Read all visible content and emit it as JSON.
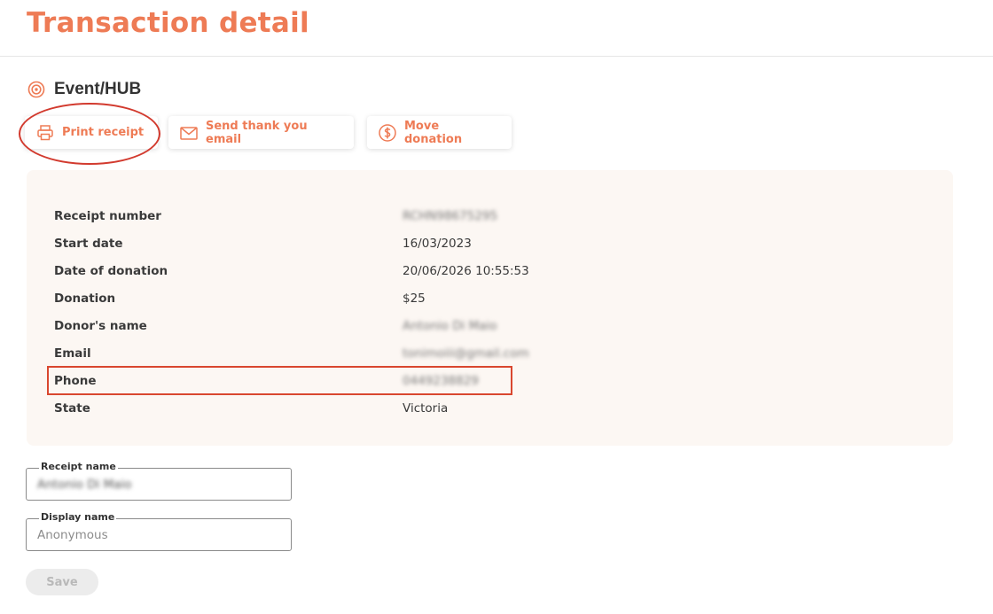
{
  "page": {
    "title": "Transaction detail"
  },
  "section": {
    "title": "Event/HUB",
    "icon": "target-icon"
  },
  "actions": {
    "print_label": "Print receipt",
    "print_icon": "printer-icon",
    "email_label": "Send thank you email",
    "email_icon": "mail-icon",
    "move_label": "Move donation",
    "move_icon": "dollar-circle-icon"
  },
  "details": [
    {
      "label": "Receipt number",
      "value": "RCHN98675295",
      "blurred": true
    },
    {
      "label": "Start date",
      "value": "16/03/2023",
      "blurred": false
    },
    {
      "label": "Date of donation",
      "value": "20/06/2026 10:55:53",
      "blurred": false
    },
    {
      "label": "Donation",
      "value": "$25",
      "blurred": false
    },
    {
      "label": "Donor's name",
      "value": "Antonio Di Maio",
      "blurred": true
    },
    {
      "label": "Email",
      "value": "tonimoiii@gmail.com",
      "blurred": true
    },
    {
      "label": "Phone",
      "value": "0449238829",
      "blurred": true
    },
    {
      "label": "State",
      "value": "Victoria",
      "blurred": false
    }
  ],
  "form": {
    "receipt_name_label": "Receipt name",
    "receipt_name_value": "Antonio Di Maio",
    "display_name_label": "Display name",
    "display_name_placeholder": "Anonymous",
    "save_label": "Save"
  },
  "colors": {
    "accent": "#ee7b55",
    "card_bg": "#fcf7f3",
    "highlight": "#d23a2e"
  }
}
